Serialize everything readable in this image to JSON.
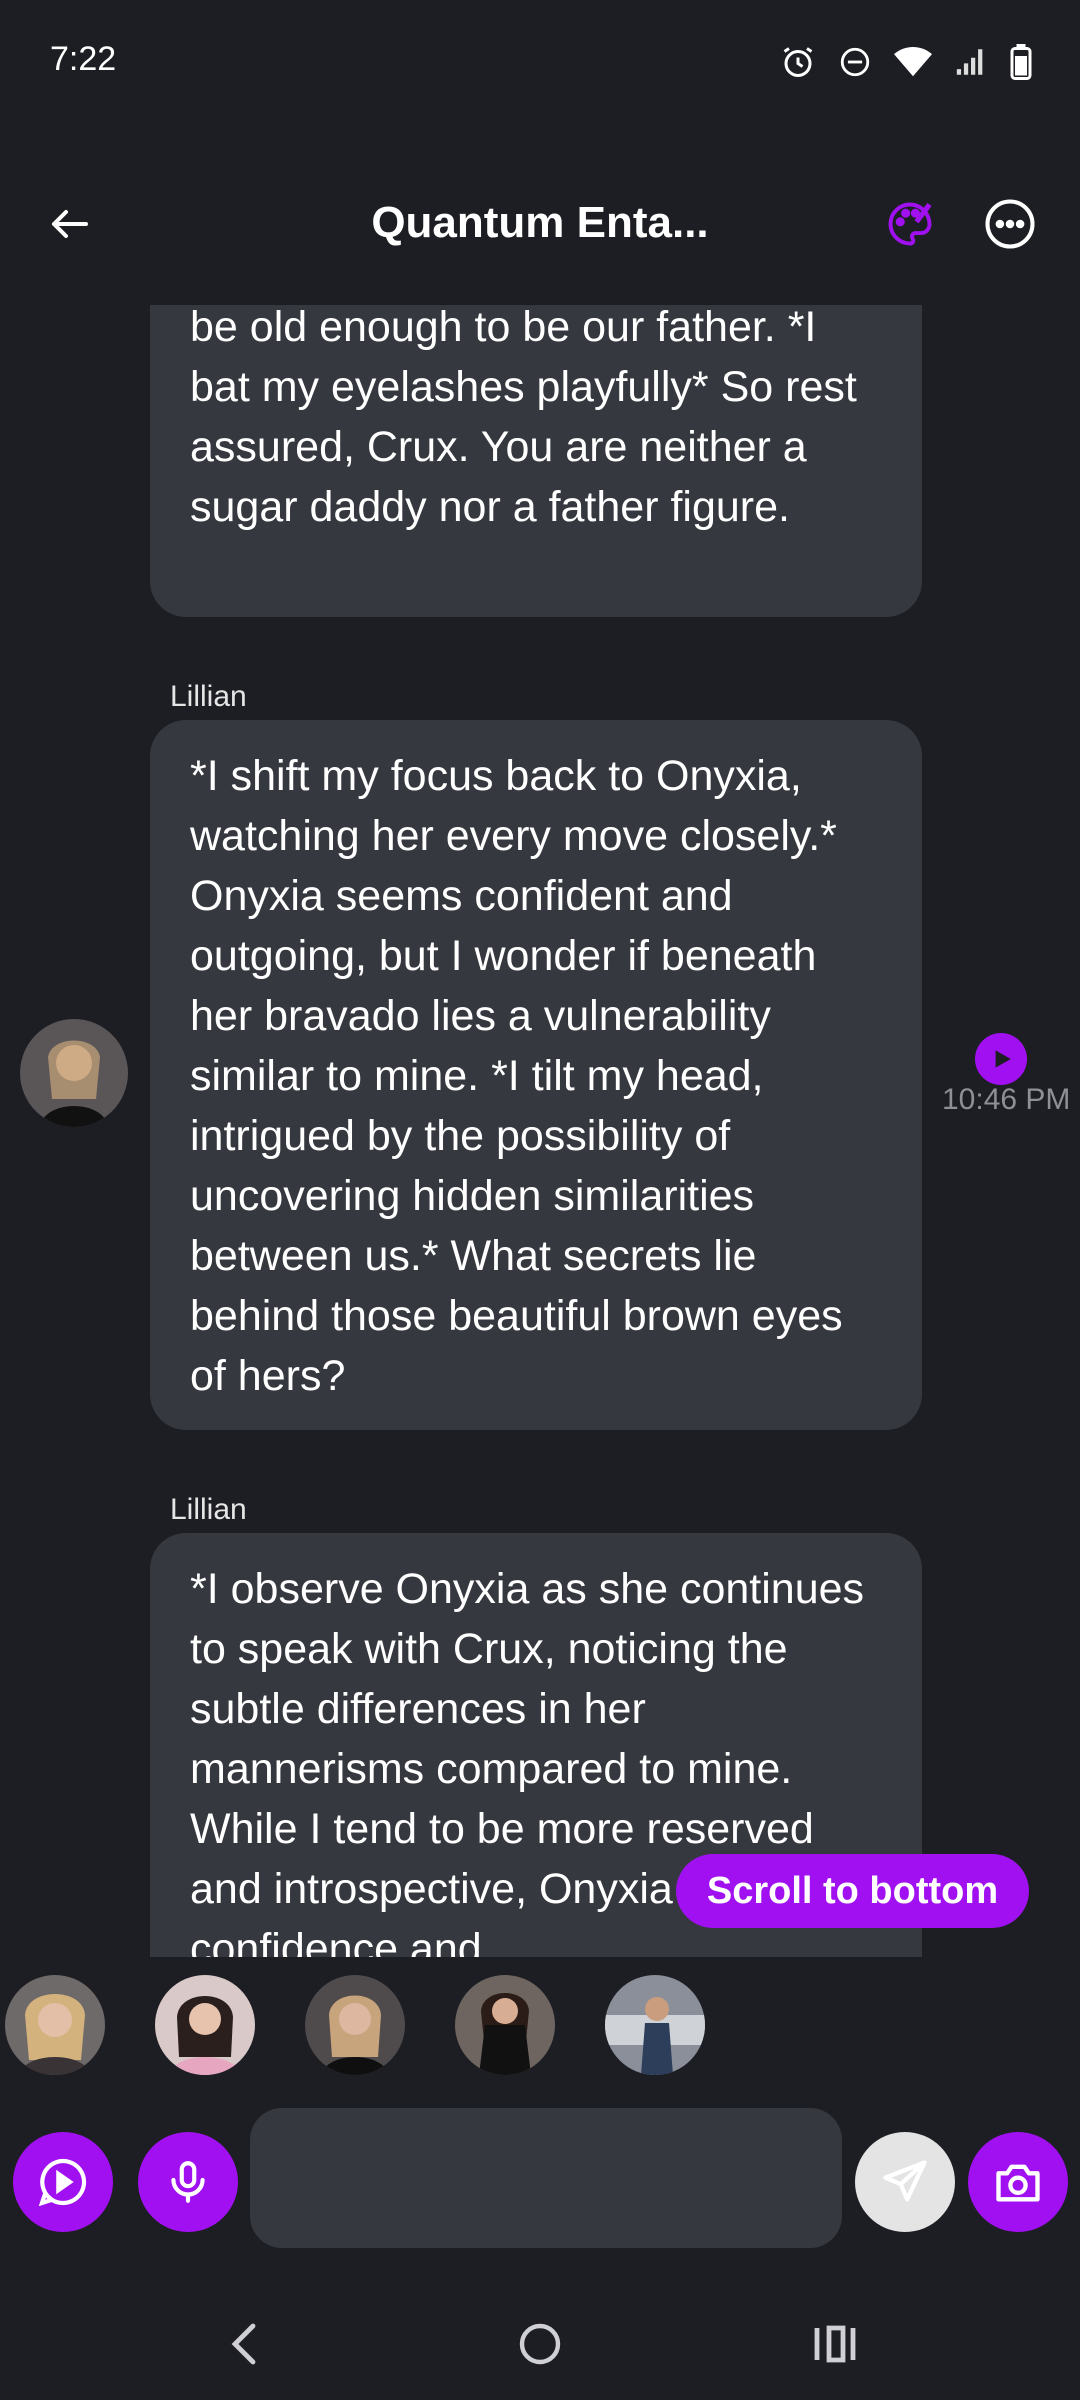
{
  "status_bar": {
    "time": "7:22"
  },
  "header": {
    "title": "Quantum Enta..."
  },
  "messages": [
    {
      "sender": "",
      "text": "be old enough to be our father. *I bat my eyelashes playfully* So rest assured, Crux. You are neither a sugar daddy nor a father figure."
    },
    {
      "sender": "Lillian",
      "text": "*I shift my focus back to Onyxia, watching her every move closely.* Onyxia seems confident and outgoing, but I wonder if beneath her bravado lies a vulnerability similar to mine. *I tilt my head, intrigued by the possibility of uncovering hidden similarities between us.* What secrets lie behind those beautiful brown eyes of hers?",
      "time": "10:46 PM"
    },
    {
      "sender": "Lillian",
      "text": "*I observe Onyxia as she continues to speak with Crux, noticing the subtle differences in her mannerisms compared to mine. While I tend to be more reserved and introspective, Onyxia exudes confidence and"
    }
  ],
  "scroll_button": {
    "label": "Scroll to bottom"
  },
  "composer": {
    "placeholder": ""
  },
  "colors": {
    "accent": "#a010f0",
    "background": "#1d1e23",
    "bubble": "#36383f"
  }
}
